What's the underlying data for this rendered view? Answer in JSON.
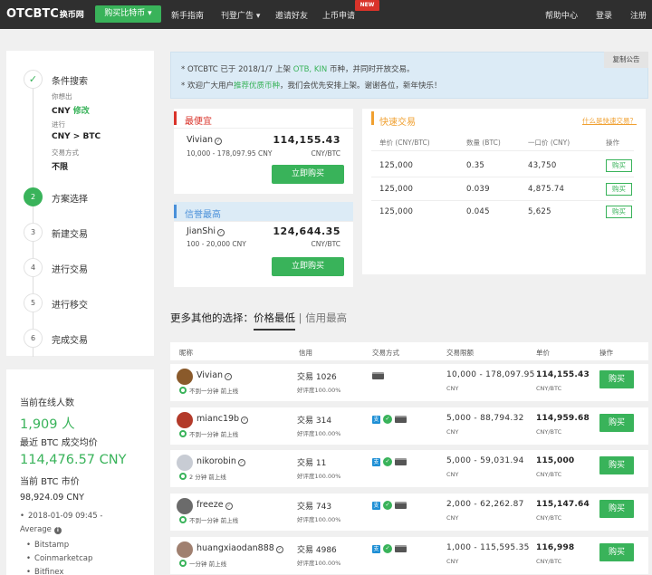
{
  "header": {
    "logo_main": "OTCBTC",
    "logo_sub": "换币网",
    "buy_button": "购买比特币 ▾",
    "nav": [
      {
        "label": "新手指南"
      },
      {
        "label": "刊登广告 ▾"
      },
      {
        "label": "邀请好友"
      },
      {
        "label": "上币申请"
      }
    ],
    "new_badge": "NEW",
    "right": [
      {
        "label": "帮助中心"
      },
      {
        "label": "登录"
      },
      {
        "label": "注册"
      }
    ]
  },
  "sidebar": {
    "step1_title": "条件搜索",
    "want_label": "你想出",
    "want_value": "CNY",
    "edit_link": "修改",
    "pair_label": "进行",
    "pair_value": "CNY > BTC",
    "method_label": "交易方式",
    "method_value": "不限",
    "steps": [
      {
        "num": "2",
        "label": "方案选择"
      },
      {
        "num": "3",
        "label": "新建交易"
      },
      {
        "num": "4",
        "label": "进行交易"
      },
      {
        "num": "5",
        "label": "进行移交"
      },
      {
        "num": "6",
        "label": "完成交易"
      }
    ]
  },
  "stats": {
    "online_label": "当前在线人数",
    "online_value": "1,909 人",
    "last_price_label": "最近 BTC 成交均价",
    "last_price_value": "114,476.57 CNY",
    "market_label": "当前 BTC 市价",
    "market_value": "98,924.09 CNY",
    "market_time": "2018-01-09 09:45 -",
    "market_avg": "Average",
    "sources": [
      "Bitstamp",
      "Coinmarketcap",
      "Bitfinex"
    ]
  },
  "notice": {
    "line1_pre": "* OTCBTC 已于 2018/1/7 上架 ",
    "line1_hl": "OTB, KIN",
    "line1_post": " 币种，并同时开放交易。",
    "line2_pre": "* 欢迎广大用户",
    "line2_hl": "推荐优质币种",
    "line2_post": "，我们会优先安排上架。谢谢各位，新年快乐！",
    "copy_btn": "复制公告"
  },
  "cheapest": {
    "title": "最便宜",
    "name": "Vivian",
    "price": "114,155.43",
    "range": "10,000 - 178,097.95 CNY",
    "unit": "CNY/BTC",
    "btn": "立即购买"
  },
  "trusted": {
    "title": "信誉最高",
    "name": "JianShi",
    "price": "124,644.35",
    "range": "100 - 20,000 CNY",
    "unit": "CNY/BTC",
    "btn": "立即购买"
  },
  "quick": {
    "title": "快速交易",
    "help_link": "什么是快速交易？",
    "cols": [
      "单价 (CNY/BTC)",
      "数量 (BTC)",
      "一口价 (CNY)",
      "操作"
    ],
    "rows": [
      {
        "price": "125,000",
        "qty": "0.35",
        "total": "43,750",
        "btn": "购买"
      },
      {
        "price": "125,000",
        "qty": "0.039",
        "total": "4,875.74",
        "btn": "购买"
      },
      {
        "price": "125,000",
        "qty": "0.045",
        "total": "5,625",
        "btn": "购买"
      }
    ]
  },
  "more": {
    "title": "更多其他的选择：",
    "tab_active": "价格最低",
    "sep": " | ",
    "tab_alt": "信用最高",
    "cols": [
      "昵称",
      "信用",
      "交易方式",
      "交易限额",
      "单价",
      "操作"
    ],
    "rows": [
      {
        "name": "Vivian",
        "online": "不到一分钟 前上线",
        "trades": "交易 1026",
        "rating": "好评度100.00%",
        "limit": "10,000 - 178,097.95",
        "cur": "CNY",
        "price": "114,155.43",
        "unit": "CNY/BTC",
        "btn": "购买",
        "pay": [
          "bank"
        ],
        "avatar_color": "#8a5a2b"
      },
      {
        "name": "mianc19b",
        "online": "不到一分钟 前上线",
        "trades": "交易 314",
        "rating": "好评度100.00%",
        "limit": "5,000 - 88,794.32",
        "cur": "CNY",
        "price": "114,959.68",
        "unit": "CNY/BTC",
        "btn": "购买",
        "pay": [
          "alipay",
          "wechat",
          "bank"
        ],
        "avatar_color": "#b33a2a"
      },
      {
        "name": "nikorobin",
        "online": "2 分钟 前上线",
        "trades": "交易 11",
        "rating": "好评度100.00%",
        "limit": "5,000 - 59,031.94",
        "cur": "CNY",
        "price": "115,000",
        "unit": "CNY/BTC",
        "btn": "购买",
        "pay": [
          "alipay",
          "wechat",
          "bank"
        ],
        "avatar_color": "#c8ccd4"
      },
      {
        "name": "freeze",
        "online": "不到一分钟 前上线",
        "trades": "交易 743",
        "rating": "好评度100.00%",
        "limit": "2,000 - 62,262.87",
        "cur": "CNY",
        "price": "115,147.64",
        "unit": "CNY/BTC",
        "btn": "购买",
        "pay": [
          "alipay",
          "wechat",
          "bank"
        ],
        "avatar_color": "#6b6b6b"
      },
      {
        "name": "huangxiaodan888",
        "online": "一分钟 前上线",
        "trades": "交易 4986",
        "rating": "好评度100.00%",
        "limit": "1,000 - 115,595.35",
        "cur": "CNY",
        "price": "116,998",
        "unit": "CNY/BTC",
        "btn": "购买",
        "pay": [
          "alipay",
          "wechat",
          "bank"
        ],
        "avatar_color": "#a08070"
      }
    ]
  },
  "colors": {
    "accent": "#39b35a",
    "header": "#2f2f2f",
    "cheapest_bar": "#d9332a",
    "trusted_bar": "#4a90d9",
    "quick_bar": "#f0a030"
  }
}
